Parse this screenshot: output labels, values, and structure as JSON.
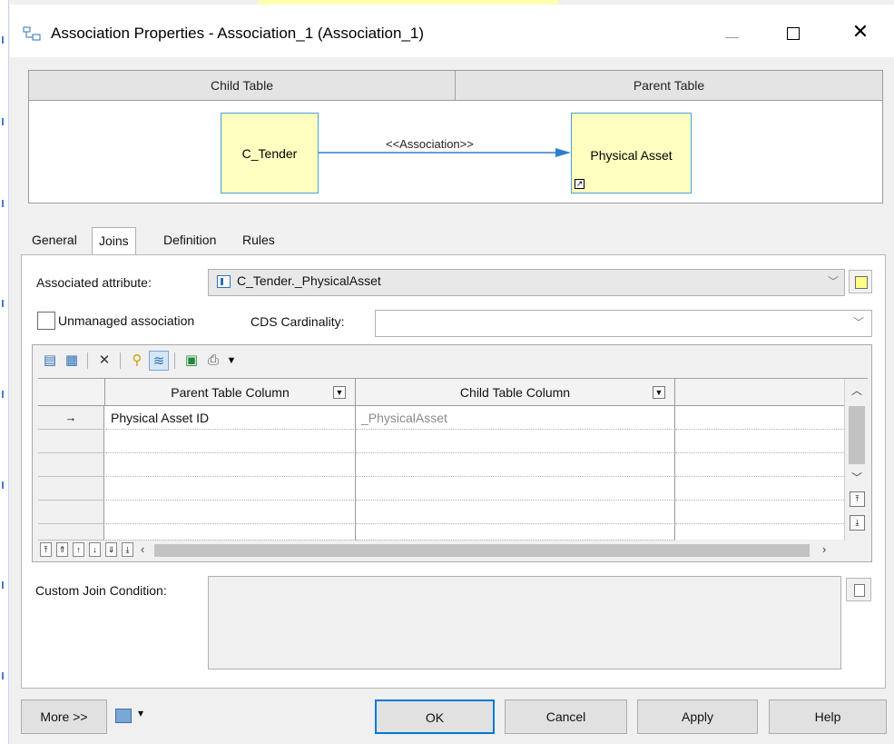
{
  "window": {
    "title": "Association Properties - Association_1 (Association_1)",
    "close_glyph": "✕"
  },
  "diagram": {
    "child_header": "Child Table",
    "parent_header": "Parent Table",
    "child_entity": "C_Tender",
    "parent_entity": "Physical Asset",
    "association_label": "<<Association>>",
    "entity_fill": "#ffffc0",
    "entity_border": "#4aa0d8",
    "link_color": "#2f7fc8"
  },
  "tabs": [
    {
      "label": "General",
      "active": false
    },
    {
      "label": "Joins",
      "active": true
    },
    {
      "label": "Definition",
      "active": false
    },
    {
      "label": "Rules",
      "active": false
    }
  ],
  "joins": {
    "associated_attribute_label": "Associated attribute:",
    "associated_attribute_value": "C_Tender._PhysicalAsset",
    "unmanaged_label": "Unmanaged association",
    "unmanaged_checked": false,
    "cds_cardinality_label": "CDS Cardinality:",
    "cds_cardinality_value": "",
    "grid": {
      "columns": [
        "Parent Table Column",
        "Child Table Column"
      ],
      "rows": [
        {
          "marker": "→",
          "parent": "Physical Asset ID",
          "child": "_PhysicalAsset"
        }
      ]
    },
    "custom_join_label": "Custom Join Condition:",
    "custom_join_value": ""
  },
  "footer": {
    "more": "More >>",
    "ok": "OK",
    "cancel": "Cancel",
    "apply": "Apply",
    "help": "Help"
  }
}
